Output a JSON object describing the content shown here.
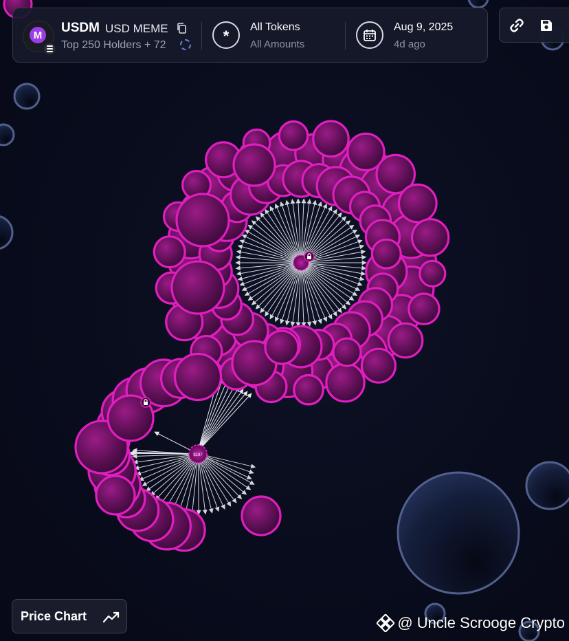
{
  "token": {
    "symbol": "USDM",
    "name": "USD MEME",
    "logo_letter": "M",
    "holders_label": "Top 250 Holders + 72"
  },
  "filters": {
    "tokens_title": "All Tokens",
    "tokens_sub": "All Amounts",
    "date_title": "Aug 9, 2025",
    "date_sub": "4d ago"
  },
  "actions": {
    "link_icon": "link-icon",
    "save_icon": "save-icon"
  },
  "footer": {
    "price_chart_label": "Price Chart",
    "price_chart_icon": "trend-icon"
  },
  "watermark": {
    "text": "@ Uncle Scrooge Crypto",
    "brand_icon": "binance-icon"
  },
  "graph": {
    "cluster_color": "#e01ec0",
    "hub_label": "$197"
  },
  "colors": {
    "background": "#090c1c",
    "accent_purple": "#9b3ee6",
    "bubble_outline": "#e01ec0",
    "inactive_bubble": "#5a6a98"
  }
}
